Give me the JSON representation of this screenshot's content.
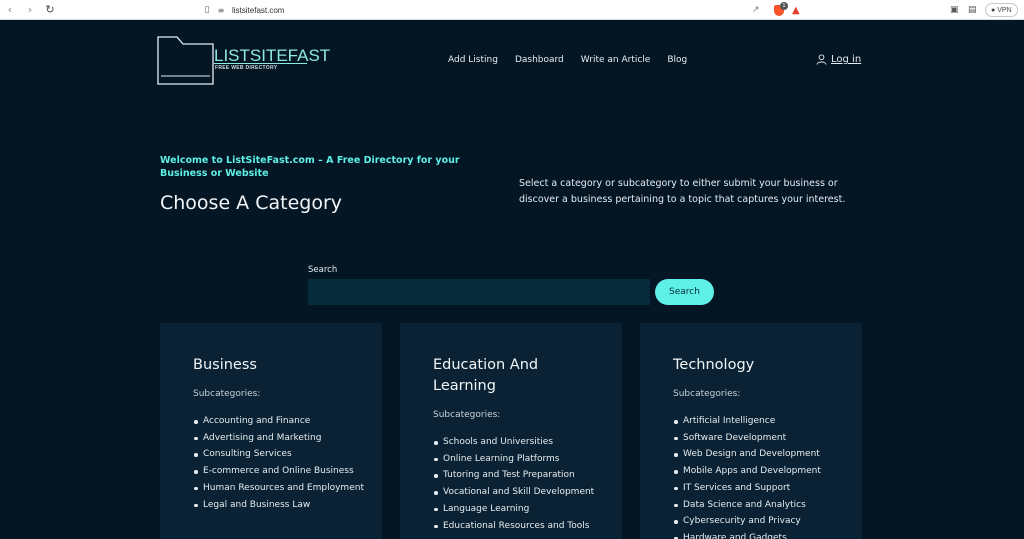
{
  "browser": {
    "url": "listsitefast.com",
    "brave_badge": "1",
    "vpn_label": "VPN"
  },
  "site": {
    "logo_name": "LISTSITEFAST",
    "logo_tagline": "FREE WEB DIRECTORY",
    "nav": [
      "Add Listing",
      "Dashboard",
      "Write an Article",
      "Blog"
    ],
    "login_label": "Log in"
  },
  "hero": {
    "welcome": "Welcome to ListSiteFast.com – A Free Directory for your Business or Website",
    "title": "Choose A Category",
    "intro": "Select a category or subcategory to either submit your business or discover a business pertaining to a topic that captures your interest."
  },
  "search": {
    "label": "Search",
    "value": "",
    "placeholder": "",
    "button": "Search"
  },
  "categories": [
    {
      "title": "Business",
      "sub_label": "Subcategories:",
      "items": [
        "Accounting and Finance",
        "Advertising and Marketing",
        "Consulting Services",
        "E-commerce and Online Business",
        "Human Resources and Employment",
        "Legal and Business Law"
      ]
    },
    {
      "title": "Education And Learning",
      "sub_label": "Subcategories:",
      "items": [
        "Schools and Universities",
        "Online Learning Platforms",
        "Tutoring and Test Preparation",
        "Vocational and Skill Development",
        "Language Learning",
        "Educational Resources and Tools"
      ]
    },
    {
      "title": "Technology",
      "sub_label": "Subcategories:",
      "items": [
        "Artificial Intelligence",
        "Software Development",
        "Web Design and Development",
        "Mobile Apps and Development",
        "IT Services and Support",
        "Data Science and Analytics",
        "Cybersecurity and Privacy",
        "Hardware and Gadgets"
      ]
    }
  ]
}
